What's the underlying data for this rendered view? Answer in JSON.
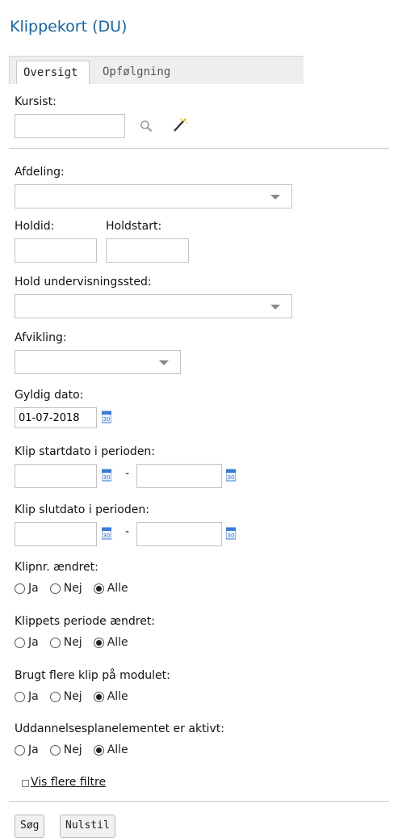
{
  "page": {
    "title": "Klippekort (DU)"
  },
  "tabs": [
    {
      "label": "Oversigt",
      "active": true
    },
    {
      "label": "Opfølgning",
      "active": false
    }
  ],
  "fields": {
    "kursist": {
      "label": "Kursist:",
      "value": ""
    },
    "afdeling": {
      "label": "Afdeling:",
      "value": ""
    },
    "holdid": {
      "label": "Holdid:",
      "value": ""
    },
    "holdstart": {
      "label": "Holdstart:",
      "value": ""
    },
    "hold_undervisningssted": {
      "label": "Hold undervisningssted:",
      "value": ""
    },
    "afvikling": {
      "label": "Afvikling:",
      "value": ""
    },
    "gyldig_dato": {
      "label": "Gyldig dato:",
      "value": "01-07-2018",
      "calendar_day": "30"
    },
    "klip_startdato": {
      "label": "Klip startdato i perioden:",
      "separator": "-",
      "from": "",
      "to": ""
    },
    "klip_slutdato": {
      "label": "Klip slutdato i perioden:",
      "separator": "-",
      "from": "",
      "to": ""
    }
  },
  "radio_groups": [
    {
      "label": "Klipnr. ændret:",
      "options": [
        "Ja",
        "Nej",
        "Alle"
      ],
      "selected": "Alle"
    },
    {
      "label": "Klippets periode ændret:",
      "options": [
        "Ja",
        "Nej",
        "Alle"
      ],
      "selected": "Alle"
    },
    {
      "label": "Brugt flere klip på modulet:",
      "options": [
        "Ja",
        "Nej",
        "Alle"
      ],
      "selected": "Alle"
    },
    {
      "label": "Uddannelsesplanelementet er aktivt:",
      "options": [
        "Ja",
        "Nej",
        "Alle"
      ],
      "selected": "Alle"
    }
  ],
  "more_filters": {
    "label": "Vis flere filtre"
  },
  "buttons": {
    "search": "Søg",
    "reset": "Nulstil"
  },
  "icons": [
    "search-icon",
    "magic-wand-icon",
    "calendar-icon",
    "dropdown-caret-icon",
    "expand-square-icon"
  ],
  "colors": {
    "title": "#1565a6",
    "tab_bar": "#eeeeee",
    "calendar": "#3a7bd5"
  }
}
